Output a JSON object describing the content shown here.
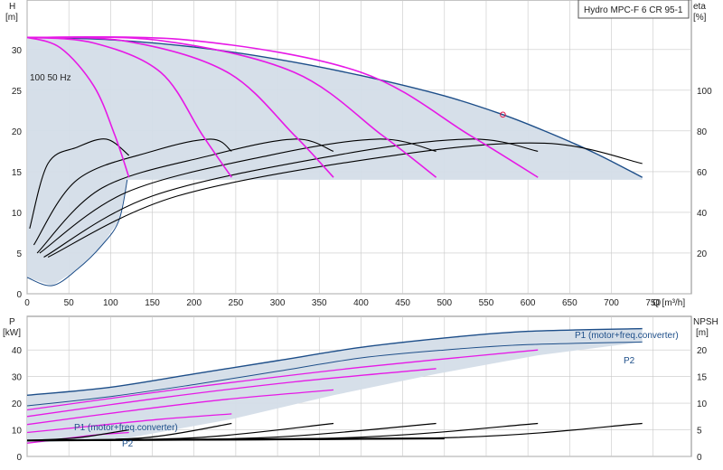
{
  "title": "Hydro MPC-F 6 CR 95-1",
  "colors": {
    "envelope_fill": "#d4dde8",
    "envelope_line": "#1d4e89",
    "speed_curve": "#e619e6",
    "black_curve": "#000000",
    "grid": "#c8c8c8",
    "marker": "#e6194b"
  },
  "chart_data": [
    {
      "type": "line",
      "name": "head-eta-chart",
      "title": "Hydro MPC-F 6 CR 95-1",
      "ylabel": "H",
      "yunit": "[m]",
      "y2label": "eta",
      "y2unit": "[%]",
      "xlabel": "Q [m³/h]",
      "xlim": [
        0,
        760
      ],
      "ylim": [
        0,
        35
      ],
      "y2lim": [
        0,
        140
      ],
      "xticks": [
        0,
        50,
        100,
        150,
        200,
        250,
        300,
        350,
        400,
        450,
        500,
        550,
        600,
        650,
        700,
        750
      ],
      "yticks": [
        0,
        5,
        10,
        15,
        20,
        25,
        30
      ],
      "y2ticks": [
        20,
        40,
        60,
        80,
        100
      ],
      "annotation": "100 50 Hz",
      "operating_point": {
        "x": 570,
        "y": 22
      },
      "envelope": {
        "max_curve": [
          [
            0,
            31.5
          ],
          [
            100,
            31.2
          ],
          [
            200,
            30.3
          ],
          [
            300,
            28.8
          ],
          [
            400,
            26.8
          ],
          [
            500,
            24.3
          ],
          [
            570,
            22
          ],
          [
            620,
            20
          ],
          [
            680,
            17.3
          ],
          [
            737,
            14.3
          ]
        ],
        "min_head": 14,
        "x_range": [
          120,
          737
        ]
      },
      "pump_curves_max": [
        {
          "pumps": 1,
          "points": [
            [
              0,
              31.5
            ],
            [
              40,
              30.2
            ],
            [
              80,
              25.5
            ],
            [
              105,
              19.5
            ],
            [
              122,
              14.3
            ]
          ]
        },
        {
          "pumps": 2,
          "points": [
            [
              0,
              31.5
            ],
            [
              80,
              30.8
            ],
            [
              160,
              27.2
            ],
            [
              210,
              19.5
            ],
            [
              245,
              14.3
            ]
          ]
        },
        {
          "pumps": 3,
          "points": [
            [
              0,
              31.5
            ],
            [
              120,
              31
            ],
            [
              240,
              27.2
            ],
            [
              320,
              19.5
            ],
            [
              367,
              14.3
            ]
          ]
        },
        {
          "pumps": 4,
          "points": [
            [
              0,
              31.5
            ],
            [
              160,
              31.1
            ],
            [
              320,
              27.2
            ],
            [
              425,
              19.5
            ],
            [
              490,
              14.3
            ]
          ]
        },
        {
          "pumps": 5,
          "points": [
            [
              0,
              31.5
            ],
            [
              200,
              31.1
            ],
            [
              400,
              27.2
            ],
            [
              530,
              19.5
            ],
            [
              612,
              14.3
            ]
          ]
        }
      ],
      "efficiency_curves": [
        {
          "points": [
            [
              3,
              8
            ],
            [
              25,
              16
            ],
            [
              60,
              18
            ],
            [
              95,
              19
            ],
            [
              122,
              17
            ]
          ]
        },
        {
          "points": [
            [
              8,
              6
            ],
            [
              60,
              14
            ],
            [
              150,
              17.5
            ],
            [
              220,
              19
            ],
            [
              245,
              17.5
            ]
          ]
        },
        {
          "points": [
            [
              12,
              5
            ],
            [
              90,
              13
            ],
            [
              220,
              17
            ],
            [
              320,
              19
            ],
            [
              367,
              17.5
            ]
          ]
        },
        {
          "points": [
            [
              15,
              5
            ],
            [
              120,
              12.5
            ],
            [
              290,
              17
            ],
            [
              420,
              19
            ],
            [
              490,
              17.5
            ]
          ]
        },
        {
          "points": [
            [
              20,
              4.5
            ],
            [
              150,
              12
            ],
            [
              370,
              17
            ],
            [
              530,
              19
            ],
            [
              612,
              17.5
            ]
          ]
        },
        {
          "points": [
            [
              25,
              4.5
            ],
            [
              180,
              12
            ],
            [
              440,
              17
            ],
            [
              620,
              18.5
            ],
            [
              737,
              16
            ]
          ]
        }
      ],
      "system_curves": [
        {
          "points": [
            [
              0,
              2
            ],
            [
              30,
              1
            ],
            [
              60,
              3
            ],
            [
              90,
              6
            ],
            [
              110,
              9
            ],
            [
              120,
              14
            ]
          ]
        }
      ]
    },
    {
      "type": "line",
      "name": "power-npsh-chart",
      "ylabel": "P",
      "yunit": "[kW]",
      "y2label": "NPSH",
      "y2unit": "[m]",
      "xlim": [
        0,
        760
      ],
      "ylim": [
        0,
        50
      ],
      "y2lim": [
        0,
        25
      ],
      "yticks": [
        0,
        10,
        20,
        30,
        40
      ],
      "y2ticks": [
        0,
        5,
        10,
        15,
        20
      ],
      "label_p1_top": "P1 (motor+freq.converter)",
      "label_p2_top": "P2",
      "label_p1_bottom": "P1 (motor+freq.converter)",
      "label_p2_bottom": "P2",
      "p1_envelope": [
        [
          0,
          23
        ],
        [
          100,
          26
        ],
        [
          200,
          31
        ],
        [
          300,
          36
        ],
        [
          400,
          41
        ],
        [
          500,
          44.5
        ],
        [
          600,
          47
        ],
        [
          737,
          48
        ]
      ],
      "p2_envelope": [
        [
          0,
          19
        ],
        [
          100,
          22.5
        ],
        [
          200,
          27
        ],
        [
          300,
          32
        ],
        [
          400,
          37
        ],
        [
          500,
          40
        ],
        [
          600,
          42
        ],
        [
          737,
          43
        ]
      ],
      "speed_power_curves": [
        {
          "pumps": 5,
          "points": [
            [
              0,
              17.5
            ],
            [
              200,
              26
            ],
            [
              400,
              33.5
            ],
            [
              612,
              40
            ]
          ]
        },
        {
          "pumps": 4,
          "points": [
            [
              0,
              15
            ],
            [
              160,
              22
            ],
            [
              320,
              28
            ],
            [
              490,
              33
            ]
          ]
        },
        {
          "pumps": 3,
          "points": [
            [
              0,
              12
            ],
            [
              120,
              17
            ],
            [
              240,
              21.5
            ],
            [
              367,
              25
            ]
          ]
        },
        {
          "pumps": 2,
          "points": [
            [
              0,
              9
            ],
            [
              80,
              11.5
            ],
            [
              160,
              14
            ],
            [
              245,
              16
            ]
          ]
        },
        {
          "pumps": 1,
          "points": [
            [
              0,
              5
            ],
            [
              40,
              6.5
            ],
            [
              80,
              8
            ],
            [
              122,
              9
            ]
          ]
        }
      ],
      "npsh_curves": [
        {
          "points": [
            [
              0,
              3
            ],
            [
              60,
              3.5
            ],
            [
              122,
              5
            ]
          ]
        },
        {
          "points": [
            [
              0,
              3
            ],
            [
              140,
              3.5
            ],
            [
              245,
              6.2
            ]
          ]
        },
        {
          "points": [
            [
              0,
              3
            ],
            [
              200,
              3.5
            ],
            [
              367,
              6.2
            ]
          ]
        },
        {
          "points": [
            [
              0,
              3
            ],
            [
              280,
              3.5
            ],
            [
              490,
              6.2
            ]
          ]
        },
        {
          "points": [
            [
              0,
              3
            ],
            [
              380,
              3.5
            ],
            [
              612,
              6.2
            ]
          ]
        },
        {
          "points": [
            [
              0,
              3
            ],
            [
              500,
              3.5
            ],
            [
              737,
              6.2
            ]
          ]
        }
      ]
    }
  ]
}
